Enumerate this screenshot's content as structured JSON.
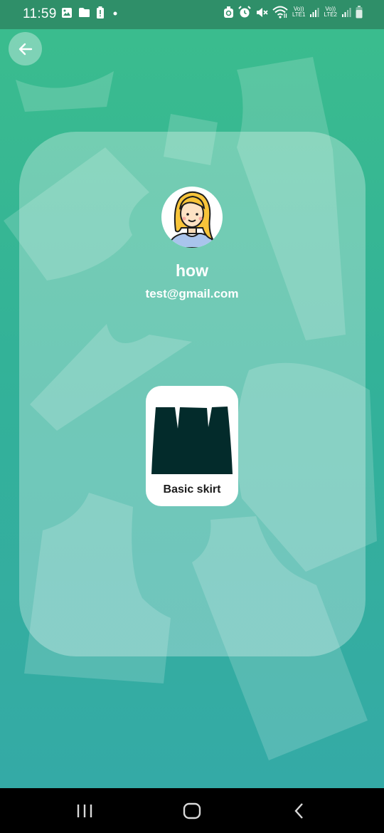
{
  "status_bar": {
    "time": "11:59",
    "left_icons": [
      "image-icon",
      "folder-icon",
      "battery-alert-icon",
      "dot-icon"
    ],
    "right_icons": [
      "recycle-icon",
      "alarm-icon",
      "mute-icon",
      "wifi-icon",
      "lte1-signal-icon",
      "lte2-signal-icon",
      "battery-icon"
    ],
    "sim1_label_top": "Vo))",
    "sim1_label_bottom": "LTE1",
    "sim2_label_top": "Vo))",
    "sim2_label_bottom": "LTE2"
  },
  "header": {
    "back_icon": "arrow-left-icon"
  },
  "profile": {
    "name": "how",
    "email": "test@gmail.com",
    "avatar_icon": "girl-avatar-icon"
  },
  "patterns": [
    {
      "label": "Basic skirt",
      "icon": "skirt-pattern-icon"
    }
  ],
  "nav": {
    "recent_icon": "recent-apps-icon",
    "home_icon": "home-icon",
    "back_icon": "nav-back-icon"
  },
  "colors": {
    "status_bar": "#2f8f69",
    "gradient_top": "#3bbd8d",
    "gradient_bottom": "#34aaa6",
    "skirt": "#032b2b",
    "card": "#ffffff"
  }
}
